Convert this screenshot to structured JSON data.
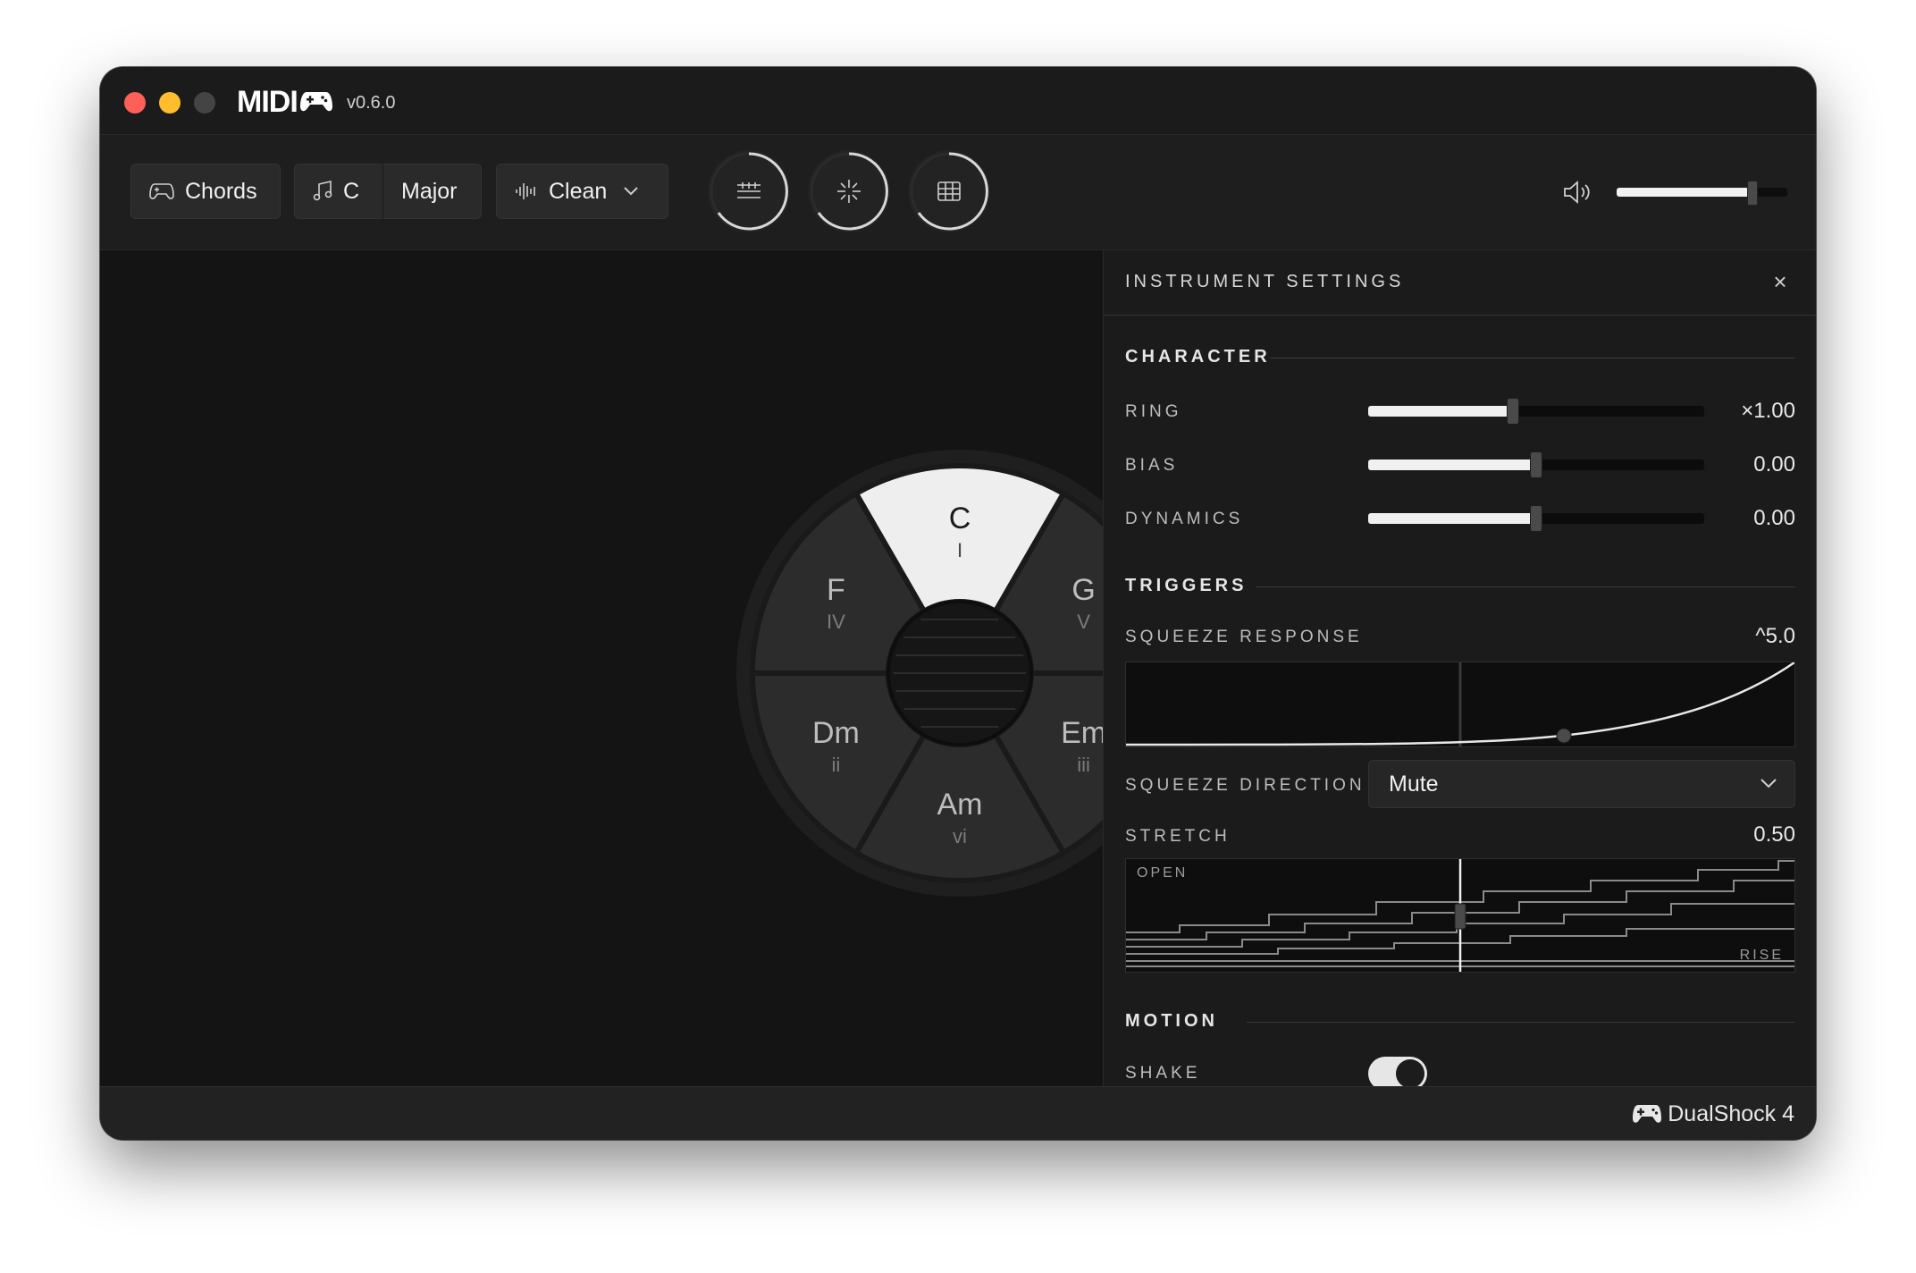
{
  "app": {
    "name": "MIDI",
    "version": "v0.6.0"
  },
  "toolbar": {
    "mode_label": "Chords",
    "key_label": "C",
    "scale_label": "Major",
    "sound_label": "Clean",
    "dials": [
      {
        "name": "keys-icon"
      },
      {
        "name": "sparkle-icon"
      },
      {
        "name": "grid-icon"
      }
    ],
    "volume_level": 0.79
  },
  "wheel": {
    "segments": [
      {
        "chord": "C",
        "numeral": "I",
        "selected": true
      },
      {
        "chord": "G",
        "numeral": "V",
        "selected": false
      },
      {
        "chord": "Em",
        "numeral": "iii",
        "selected": false
      },
      {
        "chord": "Am",
        "numeral": "vi",
        "selected": false
      },
      {
        "chord": "Dm",
        "numeral": "ii",
        "selected": false
      },
      {
        "chord": "F",
        "numeral": "IV",
        "selected": false
      }
    ]
  },
  "panel": {
    "title": "INSTRUMENT SETTINGS",
    "close_glyph": "×",
    "character": {
      "heading": "CHARACTER",
      "rows": [
        {
          "label": "RING",
          "value": "×1.00",
          "level": 0.43
        },
        {
          "label": "BIAS",
          "value": "0.00",
          "level": 0.5
        },
        {
          "label": "DYNAMICS",
          "value": "0.00",
          "level": 0.5
        }
      ]
    },
    "triggers": {
      "heading": "TRIGGERS",
      "squeeze_response_label": "SQUEEZE RESPONSE",
      "squeeze_response_value": "^5.0",
      "squeeze_direction_label": "SQUEEZE DIRECTION",
      "squeeze_direction_value": "Mute",
      "stretch_label": "STRETCH",
      "stretch_value": "0.50",
      "stretch_open_label": "OPEN",
      "stretch_rise_label": "RISE"
    },
    "motion": {
      "heading": "MOTION",
      "shake_label": "SHAKE",
      "shake_on": true
    }
  },
  "status": {
    "controller": "DualShock 4"
  },
  "colors": {
    "window_bg": "#151515",
    "panel_bg": "#1b1b1b",
    "accent": "#f0f0f0",
    "traffic_red": "#fe5f57",
    "traffic_yellow": "#febc2e"
  }
}
